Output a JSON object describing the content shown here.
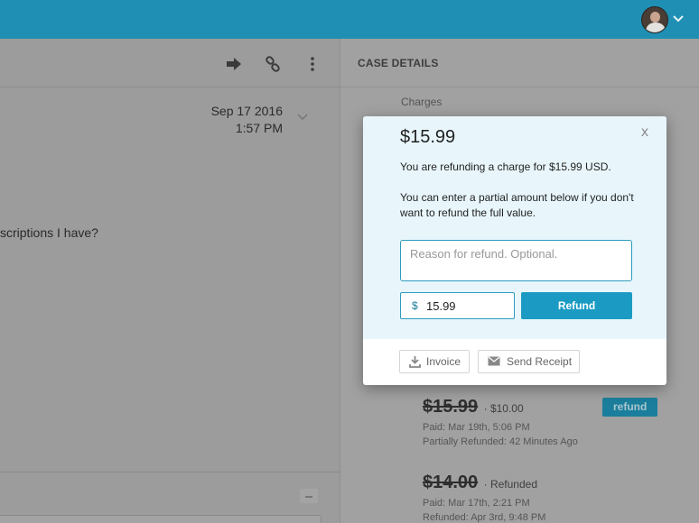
{
  "header": {
    "avatar_icon": "user-avatar",
    "menu_icon": "chevron-down-icon"
  },
  "left": {
    "toolbar_icons": [
      "forward-arrow-icon",
      "link-icon",
      "more-vertical-icon"
    ],
    "message": {
      "date": "Sep 17 2016",
      "time": "1:57 PM",
      "text": "scriptions I have?"
    }
  },
  "case_details": {
    "title": "CASE DETAILS",
    "charges_label": "Charges",
    "charges": [
      {
        "amount": "$15.99",
        "sub": "· $10.00",
        "paid": "Paid: Mar 19th, 5:06 PM",
        "status": "Partially Refunded: 42 Minutes Ago",
        "action": "refund"
      },
      {
        "amount": "$14.00",
        "sub": "· Refunded",
        "paid": "Paid: Mar 17th, 2:21 PM",
        "status": "Refunded: Apr 3rd, 9:48 PM"
      }
    ]
  },
  "modal": {
    "amount": "$15.99",
    "line1": "You are refunding a charge for $15.99 USD.",
    "line2": "You can enter a partial amount below if you don't want to refund the full value.",
    "reason_placeholder": "Reason for refund. Optional.",
    "currency_symbol": "$",
    "amount_value": "15.99",
    "refund_label": "Refund",
    "invoice_label": "Invoice",
    "send_receipt_label": "Send Receipt",
    "close_label": "x"
  },
  "colors": {
    "topbar": "#1f8fb4",
    "accent": "#1b9bc3",
    "modal_bg": "#e8f6fc",
    "overlay": "#9a9a9a"
  }
}
